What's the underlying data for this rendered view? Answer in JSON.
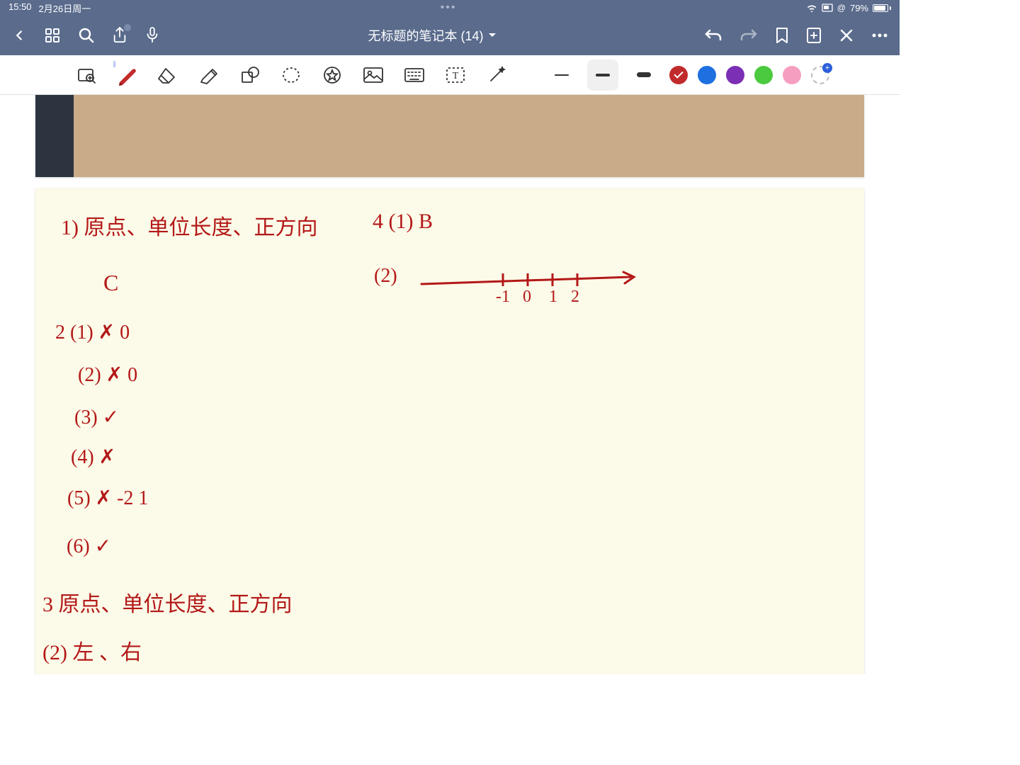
{
  "status": {
    "time": "15:50",
    "date": "2月26日周一",
    "battery_pct": "79%"
  },
  "nav": {
    "title": "无标题的笔记本 (14)"
  },
  "tools": {
    "colors": {
      "red": "#c12b2b",
      "blue": "#1e6fe0",
      "purple": "#7b2fb5",
      "green": "#4bc93f",
      "pink": "#f59ec0"
    }
  },
  "notes": {
    "line1": "1) 原点、单位长度、正方向",
    "line2": "4 (1) B",
    "line3": "C",
    "line4": "(2)",
    "numline": {
      "m1": "-1",
      "z": "0",
      "p1": "1",
      "p2": "2"
    },
    "q2_1": "2 (1)  ✗        0",
    "q2_2": "(2)  ✗        0",
    "q2_3": "(3)  ✓",
    "q2_4": "(4)  ✗",
    "q2_5": "(5)  ✗    -2   1",
    "q2_6": "(6)  ✓",
    "line11": "3 原点、单位长度、正方向",
    "line12": "(2) 左 、右"
  }
}
